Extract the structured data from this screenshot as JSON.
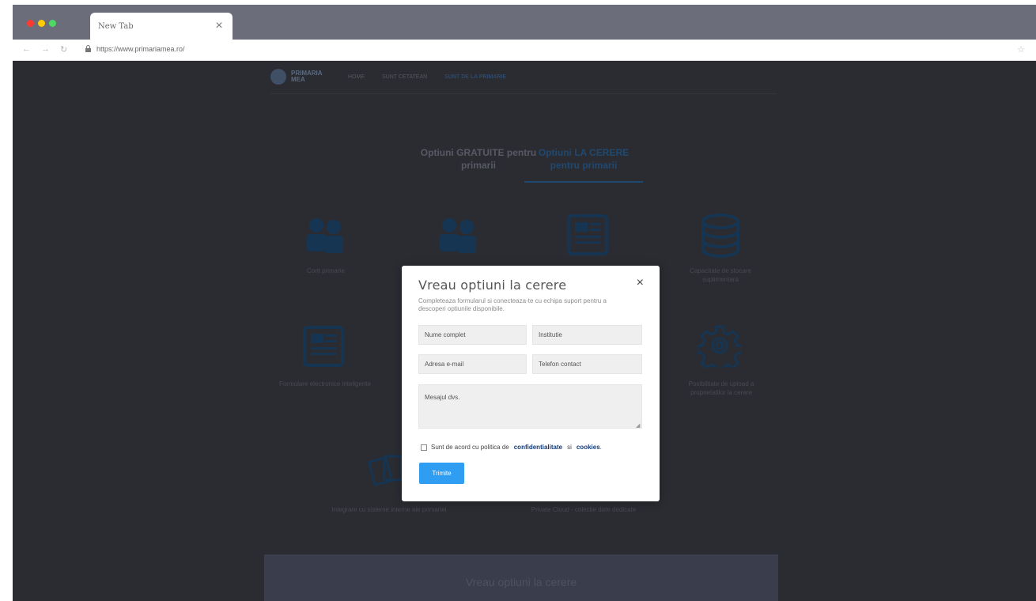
{
  "browser": {
    "tab_title": "New Tab",
    "url": "https://www.primariamea.ro/",
    "colors": {
      "red": "#ff3b30",
      "yellow": "#ffcc00",
      "green": "#4cd964"
    }
  },
  "site": {
    "logo": "PRIMARIA MEA",
    "nav": [
      "HOME",
      "SUNT CETATEAN",
      "SUNT DE LA PRIMARIE"
    ],
    "tabs": {
      "free": "Optiuni GRATUITE pentru primarii",
      "request": "Optiuni LA CERERE pentru primarii"
    },
    "features": [
      "Cont primarie",
      "Capacitate de stocare suplimentara",
      "Formulare electronice inteligente",
      "Posibilitate de upload a proprietatilor la cerere",
      "Integrare cu sisteme interne ale primariei",
      "Private Cloud - colectie date dedicate"
    ],
    "cta": "Vreau optiuni la cerere"
  },
  "modal": {
    "title": "Vreau optiuni la cerere",
    "close": "×",
    "subtitle": "Completeaza formularul si conecteaza-te cu echipa suport pentru a descoperi optiunile disponibile.",
    "fields": {
      "name": "Nume complet",
      "institution": "Institutie",
      "email": "Adresa e-mail",
      "phone": "Telefon contact",
      "message": "Mesajul dvs."
    },
    "consent_prefix": "Sunt de acord cu politica de",
    "consent_link1": "confidentialitate",
    "consent_and": "si",
    "consent_link2": "cookies",
    "consent_suffix": ".",
    "submit": "Trimite",
    "accent": "#2f9df2"
  }
}
